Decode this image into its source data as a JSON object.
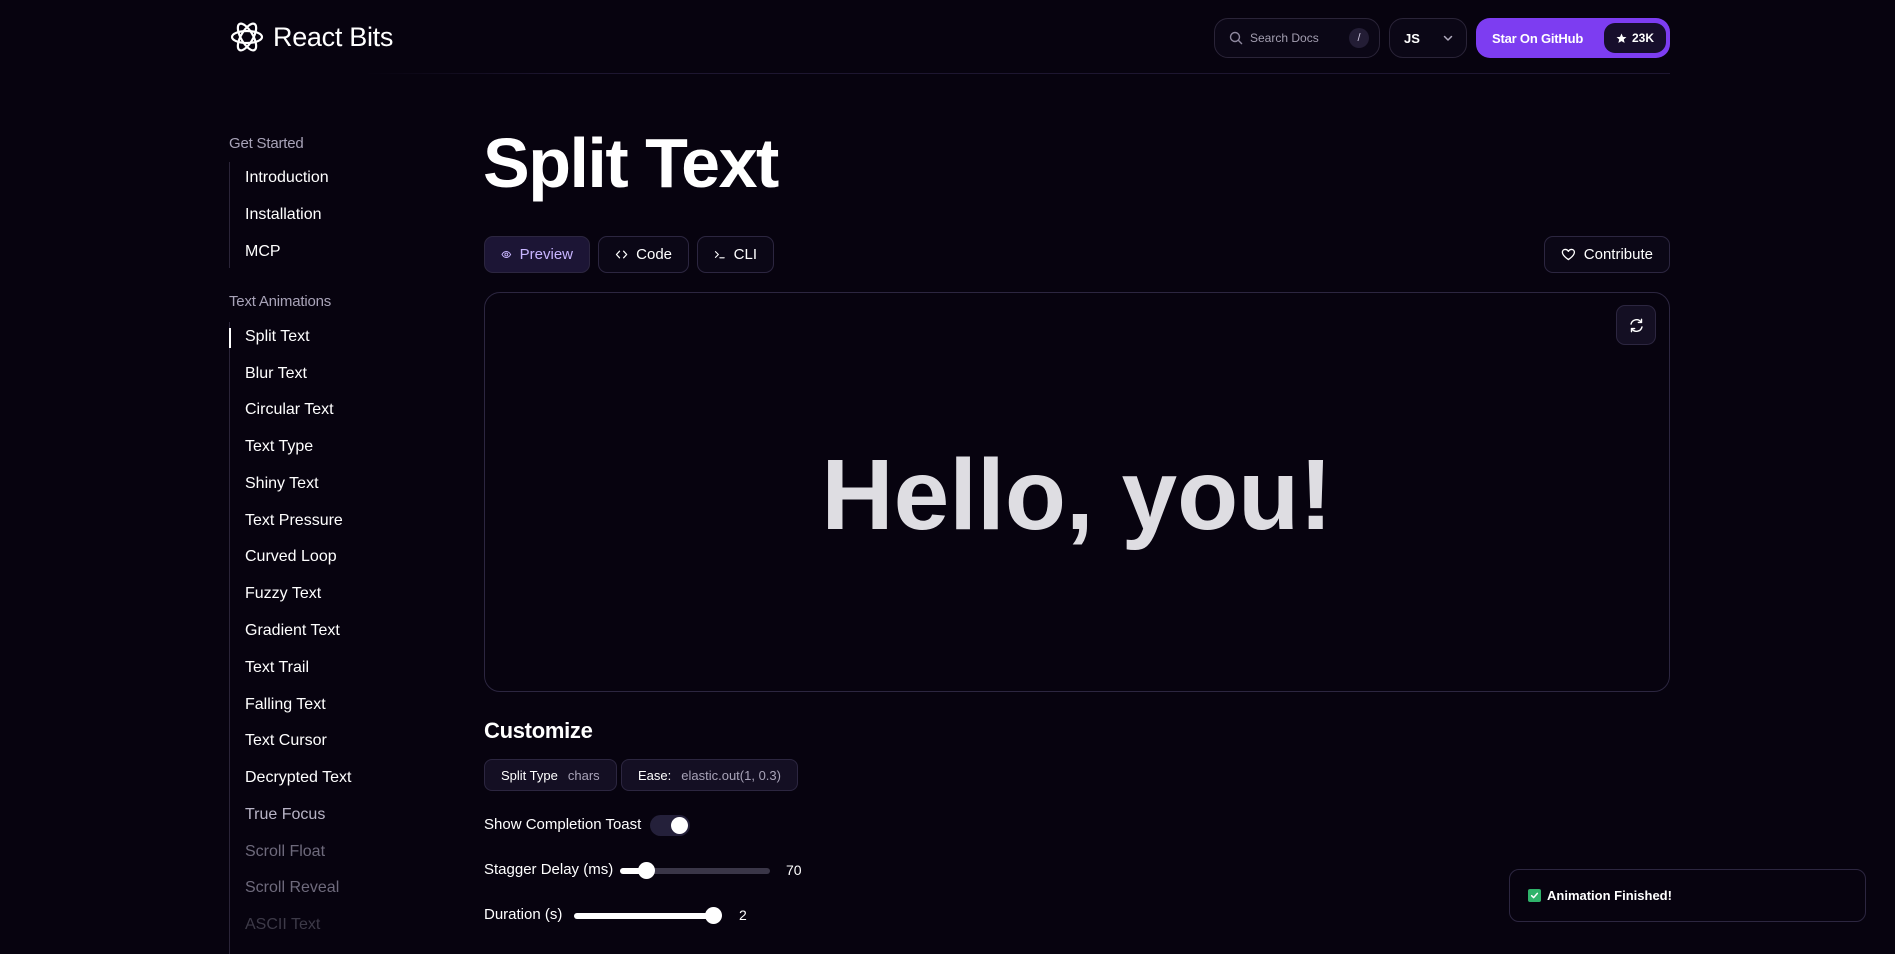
{
  "header": {
    "logo_text": "React Bits",
    "search_placeholder": "Search Docs",
    "search_shortcut": "/",
    "language": "JS",
    "github_label": "Star On GitHub",
    "github_stars": "23K"
  },
  "sidebar": {
    "get_started_title": "Get Started",
    "get_started_items": [
      "Introduction",
      "Installation",
      "MCP"
    ],
    "text_animations_title": "Text Animations",
    "text_animations_items": [
      "Split Text",
      "Blur Text",
      "Circular Text",
      "Text Type",
      "Shiny Text",
      "Text Pressure",
      "Curved Loop",
      "Fuzzy Text",
      "Gradient Text",
      "Text Trail",
      "Falling Text",
      "Text Cursor",
      "Decrypted Text",
      "True Focus",
      "Scroll Float",
      "Scroll Reveal",
      "ASCII Text"
    ],
    "active_item": "Split Text"
  },
  "main": {
    "title": "Split Text",
    "tabs": [
      {
        "label": "Preview",
        "icon": "eye-icon",
        "active": true
      },
      {
        "label": "Code",
        "icon": "code-icon",
        "active": false
      },
      {
        "label": "CLI",
        "icon": "terminal-icon",
        "active": false
      }
    ],
    "contribute_label": "Contribute",
    "preview_text": "Hello, you!",
    "customize_title": "Customize",
    "chips": [
      {
        "key": "Split Type",
        "value": "chars"
      },
      {
        "key": "Ease:",
        "value": "elastic.out(1, 0.3)"
      }
    ],
    "toggle": {
      "label": "Show Completion Toast",
      "on": true
    },
    "sliders": [
      {
        "label": "Stagger Delay (ms)",
        "value": "70",
        "fraction": 0.18
      },
      {
        "label": "Duration (s)",
        "value": "2",
        "fraction": 0.94
      }
    ]
  },
  "toast": {
    "text": "Animation Finished!"
  },
  "colors": {
    "background": "#07030f",
    "accent": "#7d3df1",
    "border": "#2c2640",
    "success": "#2fb36a"
  }
}
